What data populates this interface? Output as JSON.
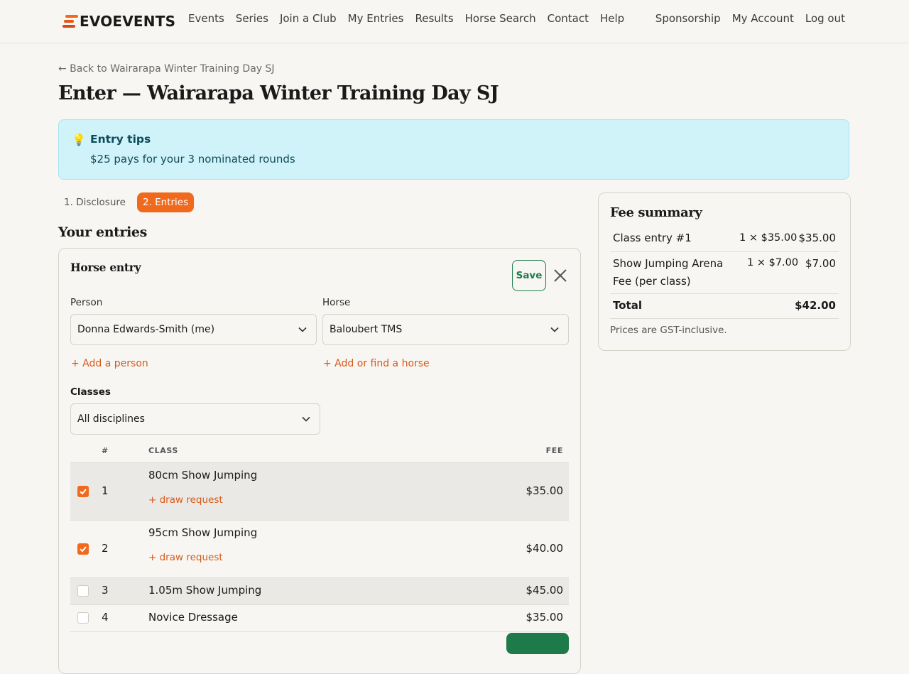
{
  "nav": {
    "logo_text": "EVOEVENTS",
    "links": [
      "Events",
      "Series",
      "Join a Club",
      "My Entries",
      "Results",
      "Horse Search",
      "Contact",
      "Help"
    ],
    "right_links": [
      "Sponsorship",
      "My Account",
      "Log out"
    ]
  },
  "page": {
    "back_link": "← Back to Wairarapa Winter Training Day SJ",
    "title": "Enter — Wairarapa Winter Training Day SJ"
  },
  "tips": {
    "icon": "lightbulb-icon",
    "title": "Entry tips",
    "body": "$25 pays for your 3 nominated rounds",
    "color": "#cff3f9"
  },
  "steps": [
    {
      "label": "1. Disclosure",
      "active": false
    },
    {
      "label": "2. Entries",
      "active": true
    }
  ],
  "entries": {
    "section_title": "Your entries",
    "card_title": "Horse entry",
    "save_label": "Save",
    "person_label": "Person",
    "person_value": "Donna Edwards-Smith (me)",
    "horse_label": "Horse",
    "horse_value": "Baloubert TMS",
    "add_person": "+ Add a person",
    "add_horse": "+ Add or find a horse",
    "classes_label": "Classes",
    "discipline_value": "All disciplines",
    "table_headers": {
      "num": "#",
      "class": "CLASS",
      "fee": "FEE"
    },
    "classes": [
      {
        "num": "1",
        "name": "80cm Show Jumping",
        "fee": "$35.00",
        "checked": true,
        "draw": "+ draw request"
      },
      {
        "num": "2",
        "name": "95cm Show Jumping",
        "fee": "$40.00",
        "checked": true,
        "draw": "+ draw request"
      },
      {
        "num": "3",
        "name": "1.05m Show Jumping",
        "fee": "$45.00",
        "checked": false,
        "draw": ""
      },
      {
        "num": "4",
        "name": "Novice Dressage",
        "fee": "$35.00",
        "checked": false,
        "draw": ""
      }
    ]
  },
  "fee_summary": {
    "title": "Fee summary",
    "rows": [
      {
        "desc": "Class entry #1",
        "qty": "1 × $35.00",
        "amount": "$35.00"
      },
      {
        "desc_line1": "Show Jumping Arena",
        "desc_line2": "Fee (per class)",
        "qty": "1 × $7.00",
        "amount": "$7.00"
      }
    ],
    "total_label": "Total",
    "total_value": "$42.00",
    "note": "Prices are GST-inclusive."
  },
  "colors": {
    "accent": "#f06a1d",
    "success": "#1f7a4a",
    "link": "#d6591a"
  }
}
